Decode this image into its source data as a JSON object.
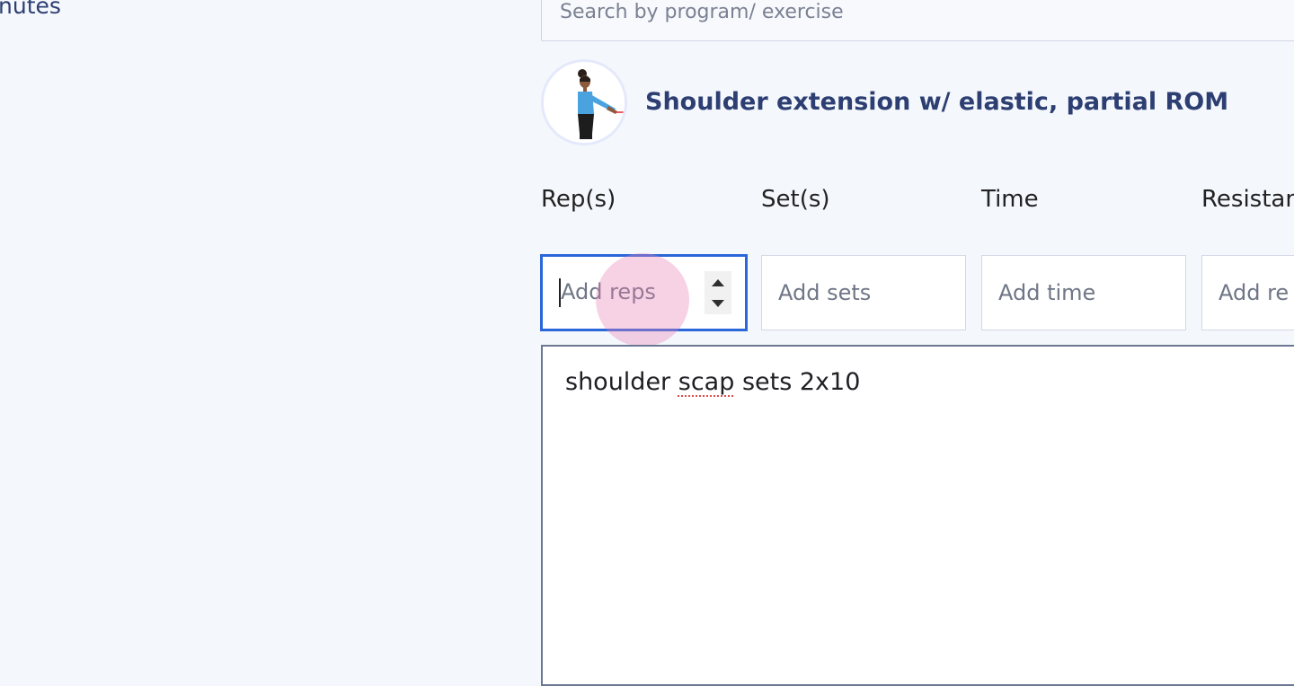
{
  "left_panel": {
    "fragment_text": "nutes"
  },
  "search": {
    "placeholder": "Search by program/ exercise"
  },
  "exercise": {
    "title": "Shoulder extension w/ elastic, partial ROM",
    "thumbnail_icon": "person-with-elastic-band"
  },
  "fields": {
    "reps": {
      "label": "Rep(s)",
      "placeholder": "Add reps",
      "value": ""
    },
    "sets": {
      "label": "Set(s)",
      "placeholder": "Add sets",
      "value": ""
    },
    "time": {
      "label": "Time",
      "placeholder": "Add time",
      "value": ""
    },
    "resistance": {
      "label": "Resistan",
      "placeholder": "Add re",
      "value": ""
    }
  },
  "notes": {
    "prefix": "shoulder ",
    "misspelled_word": "scap",
    "suffix": " sets 2x10"
  },
  "colors": {
    "page_background": "#f4f7fc",
    "accent_text": "#2d3f72",
    "focus_border": "#2b67d9",
    "click_indicator": "#e87eb4"
  }
}
